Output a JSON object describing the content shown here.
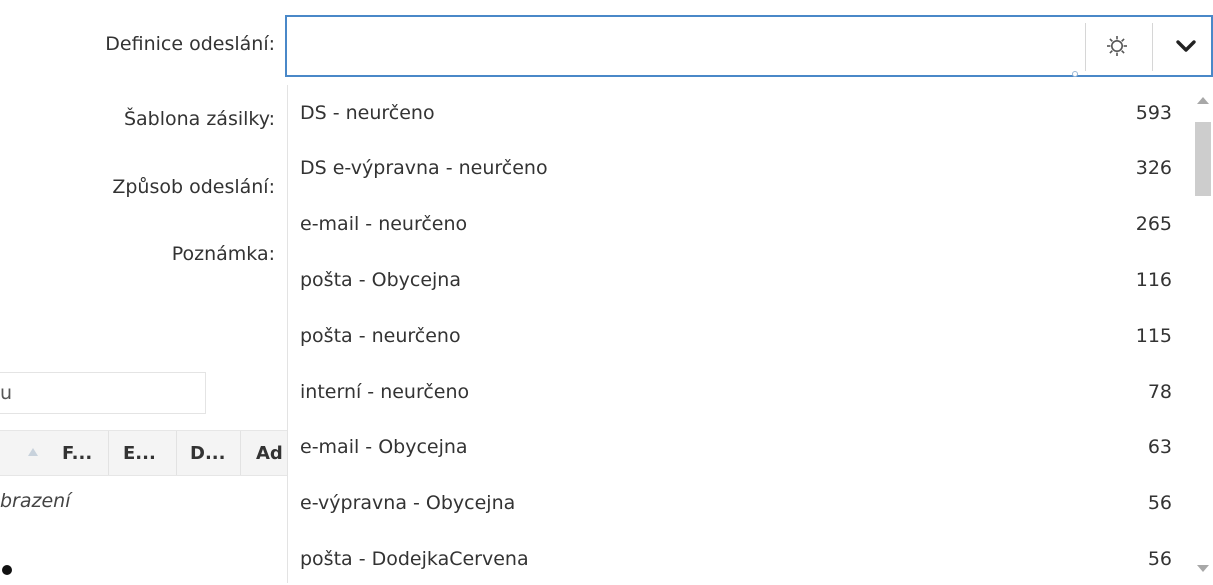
{
  "form": {
    "definice_label": "Definice odeslání:",
    "sablona_label": "Šablona zásilky:",
    "zpusob_label": "Způsob odeslání:",
    "poznamka_label": "Poznámka:",
    "definice_value": "",
    "definice_placeholder": ""
  },
  "combo": {
    "settings_icon": "gear-icon",
    "dropdown_icon": "chevron-down-icon",
    "accent_color": "#4a88c8"
  },
  "dropdown": {
    "items": [
      {
        "label": "DS - neurčeno",
        "count": "593"
      },
      {
        "label": "DS e-výpravna - neurčeno",
        "count": "326"
      },
      {
        "label": "e-mail - neurčeno",
        "count": "265"
      },
      {
        "label": "pošta - Obycejna",
        "count": "116"
      },
      {
        "label": "pošta - neurčeno",
        "count": "115"
      },
      {
        "label": "interní - neurčeno",
        "count": "78"
      },
      {
        "label": "e-mail - Obycejna",
        "count": "63"
      },
      {
        "label": "e-výpravna - Obycejna",
        "count": "56"
      },
      {
        "label": "pošta - DodejkaCervena",
        "count": "56"
      }
    ]
  },
  "background": {
    "search_fragment": "u",
    "column_headers": [
      "F...",
      "E...",
      "D...",
      "Ad"
    ],
    "empty_text_fragment": "brazení"
  }
}
